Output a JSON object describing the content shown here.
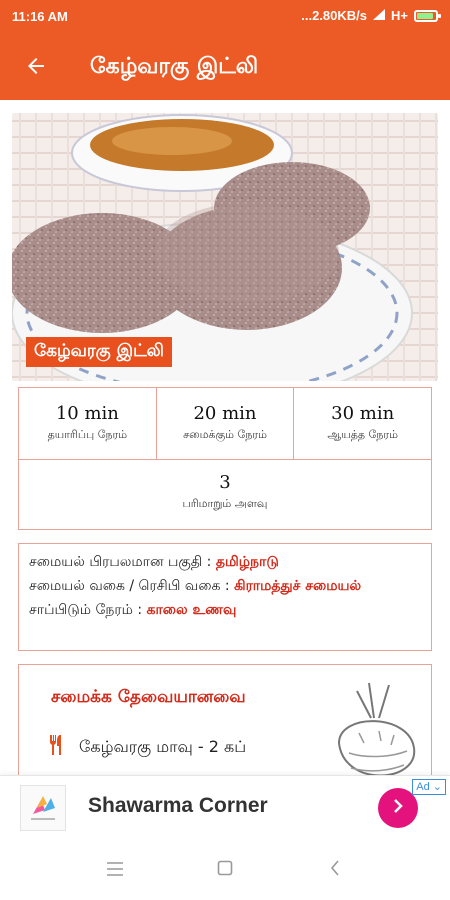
{
  "status_bar": {
    "time": "11:16 AM",
    "network": "...2.80KB/s",
    "signal_text": "H+",
    "battery_level": 0.9
  },
  "app_bar": {
    "title": "கேழ்வரகு இட்லி",
    "back_icon": "arrow-left-icon"
  },
  "hero": {
    "caption": "கேழ்வரகு இட்லி"
  },
  "times": [
    {
      "value": "10 min",
      "label": "தயாரிப்பு நேரம்"
    },
    {
      "value": "20 min",
      "label": "சமைக்கும் நேரம்"
    },
    {
      "value": "30 min",
      "label": "ஆயத்த நேரம்"
    }
  ],
  "servings": {
    "value": "3",
    "label": "பரிமாறும் அளவு"
  },
  "details": {
    "region_label": "சமையல் பிரபலமான பகுதி : ",
    "region_value": "தமிழ்நாடு",
    "type_label": "சமையல் வகை / ரெசிபி வகை : ",
    "type_value": "கிராமத்துச் சமையல்",
    "meal_label": "சாப்பிடும் நேரம் : ",
    "meal_value": "காலை உணவு"
  },
  "ingredients": {
    "heading": "சமைக்க தேவையானவை",
    "items": [
      {
        "icon": "cutlery-icon",
        "text": "கேழ்வரகு மாவு - 2 கப்"
      }
    ]
  },
  "ad": {
    "title": "Shawarma Corner",
    "badge": "Ad",
    "action_icon": "chevron-right-icon"
  },
  "nav": {
    "icons": [
      "menu-icon",
      "home-square-icon",
      "back-chevron-icon"
    ]
  },
  "colors": {
    "primary": "#ec5b26",
    "accent_text": "#d32a1a",
    "border": "#e7a39a",
    "ad_action": "#e4127c"
  }
}
